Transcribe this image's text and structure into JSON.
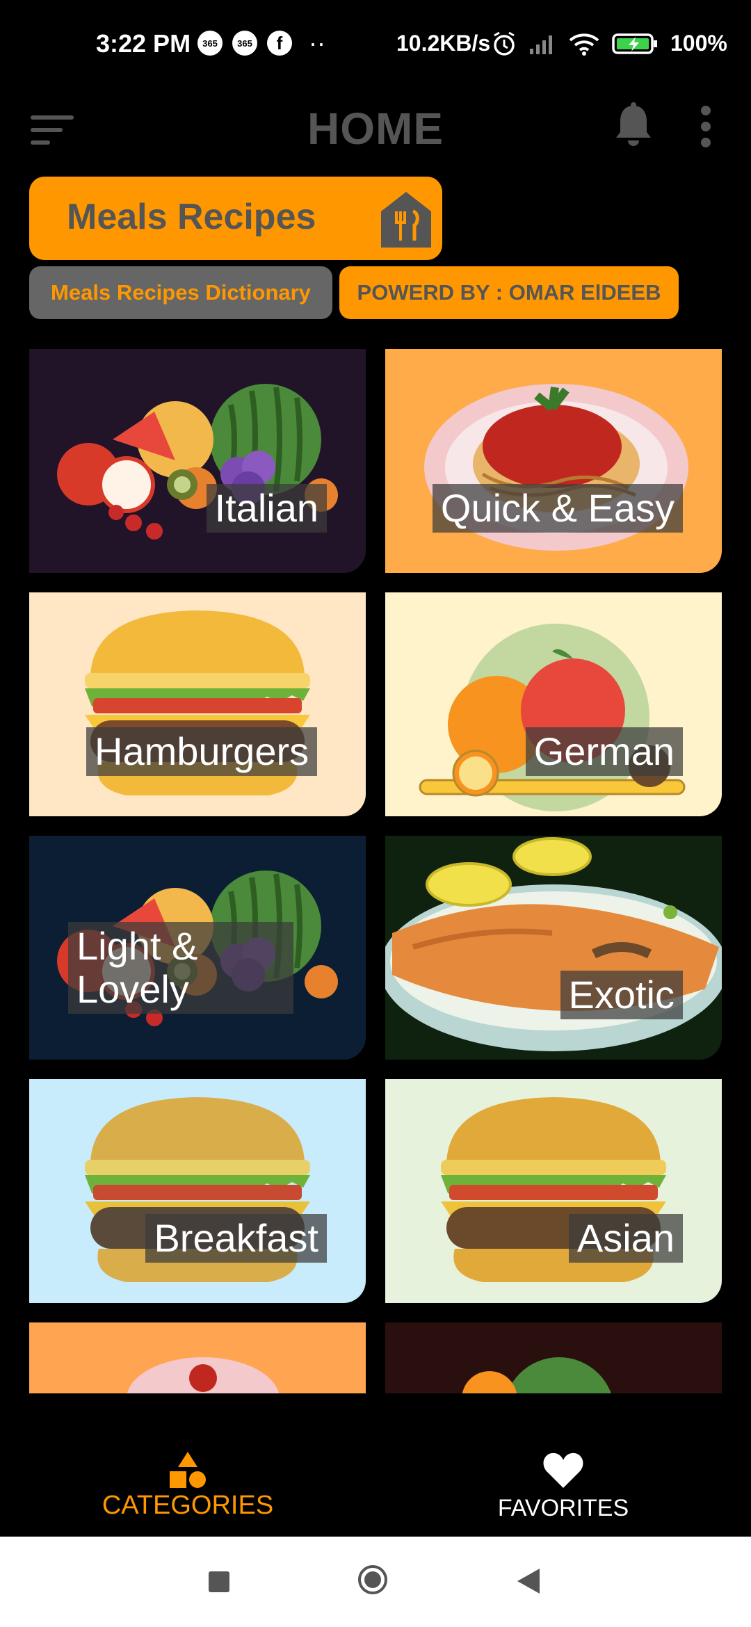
{
  "status_bar": {
    "time": "3:22 PM",
    "app_badges": [
      "365",
      "365"
    ],
    "network_speed": "10.2KB/s",
    "battery_percent": "100%"
  },
  "app_bar": {
    "title": "HOME",
    "menu_icon": "menu-icon",
    "notification_icon": "bell-icon",
    "overflow_icon": "more-vert-icon"
  },
  "banner": {
    "title": "Meals Recipes",
    "icon": "restaurant-house-icon"
  },
  "chips": {
    "dictionary": "Meals Recipes Dictionary",
    "powered_by": "POWERD BY : OMAR ElDEEB"
  },
  "categories": [
    {
      "label": "Italian",
      "art": "fruits",
      "bg": "#211428"
    },
    {
      "label": "Quick & Easy",
      "art": "spaghetti",
      "bg": "#ffab4a"
    },
    {
      "label": "Hamburgers",
      "art": "burger",
      "bg": "#ffe6c4"
    },
    {
      "label": "German",
      "art": "orange-apple",
      "bg": "#fff3cc"
    },
    {
      "label": "Light &\nLovely",
      "art": "fruits",
      "bg": "#0b1e33"
    },
    {
      "label": "Exotic",
      "art": "salmon",
      "bg": "#0f2210"
    },
    {
      "label": "Breakfast",
      "art": "burger",
      "bg": "#c8ecfb"
    },
    {
      "label": "Asian",
      "art": "burger",
      "bg": "#e6f2dc"
    },
    {
      "label": "",
      "art": "partial",
      "bg": "#ffa552"
    },
    {
      "label": "",
      "art": "partial-dark",
      "bg": "#2a0f0f"
    }
  ],
  "bottom_nav": {
    "categories_label": "CATEGORIES",
    "favorites_label": "FAVORITES",
    "active_color": "#ff9800"
  }
}
